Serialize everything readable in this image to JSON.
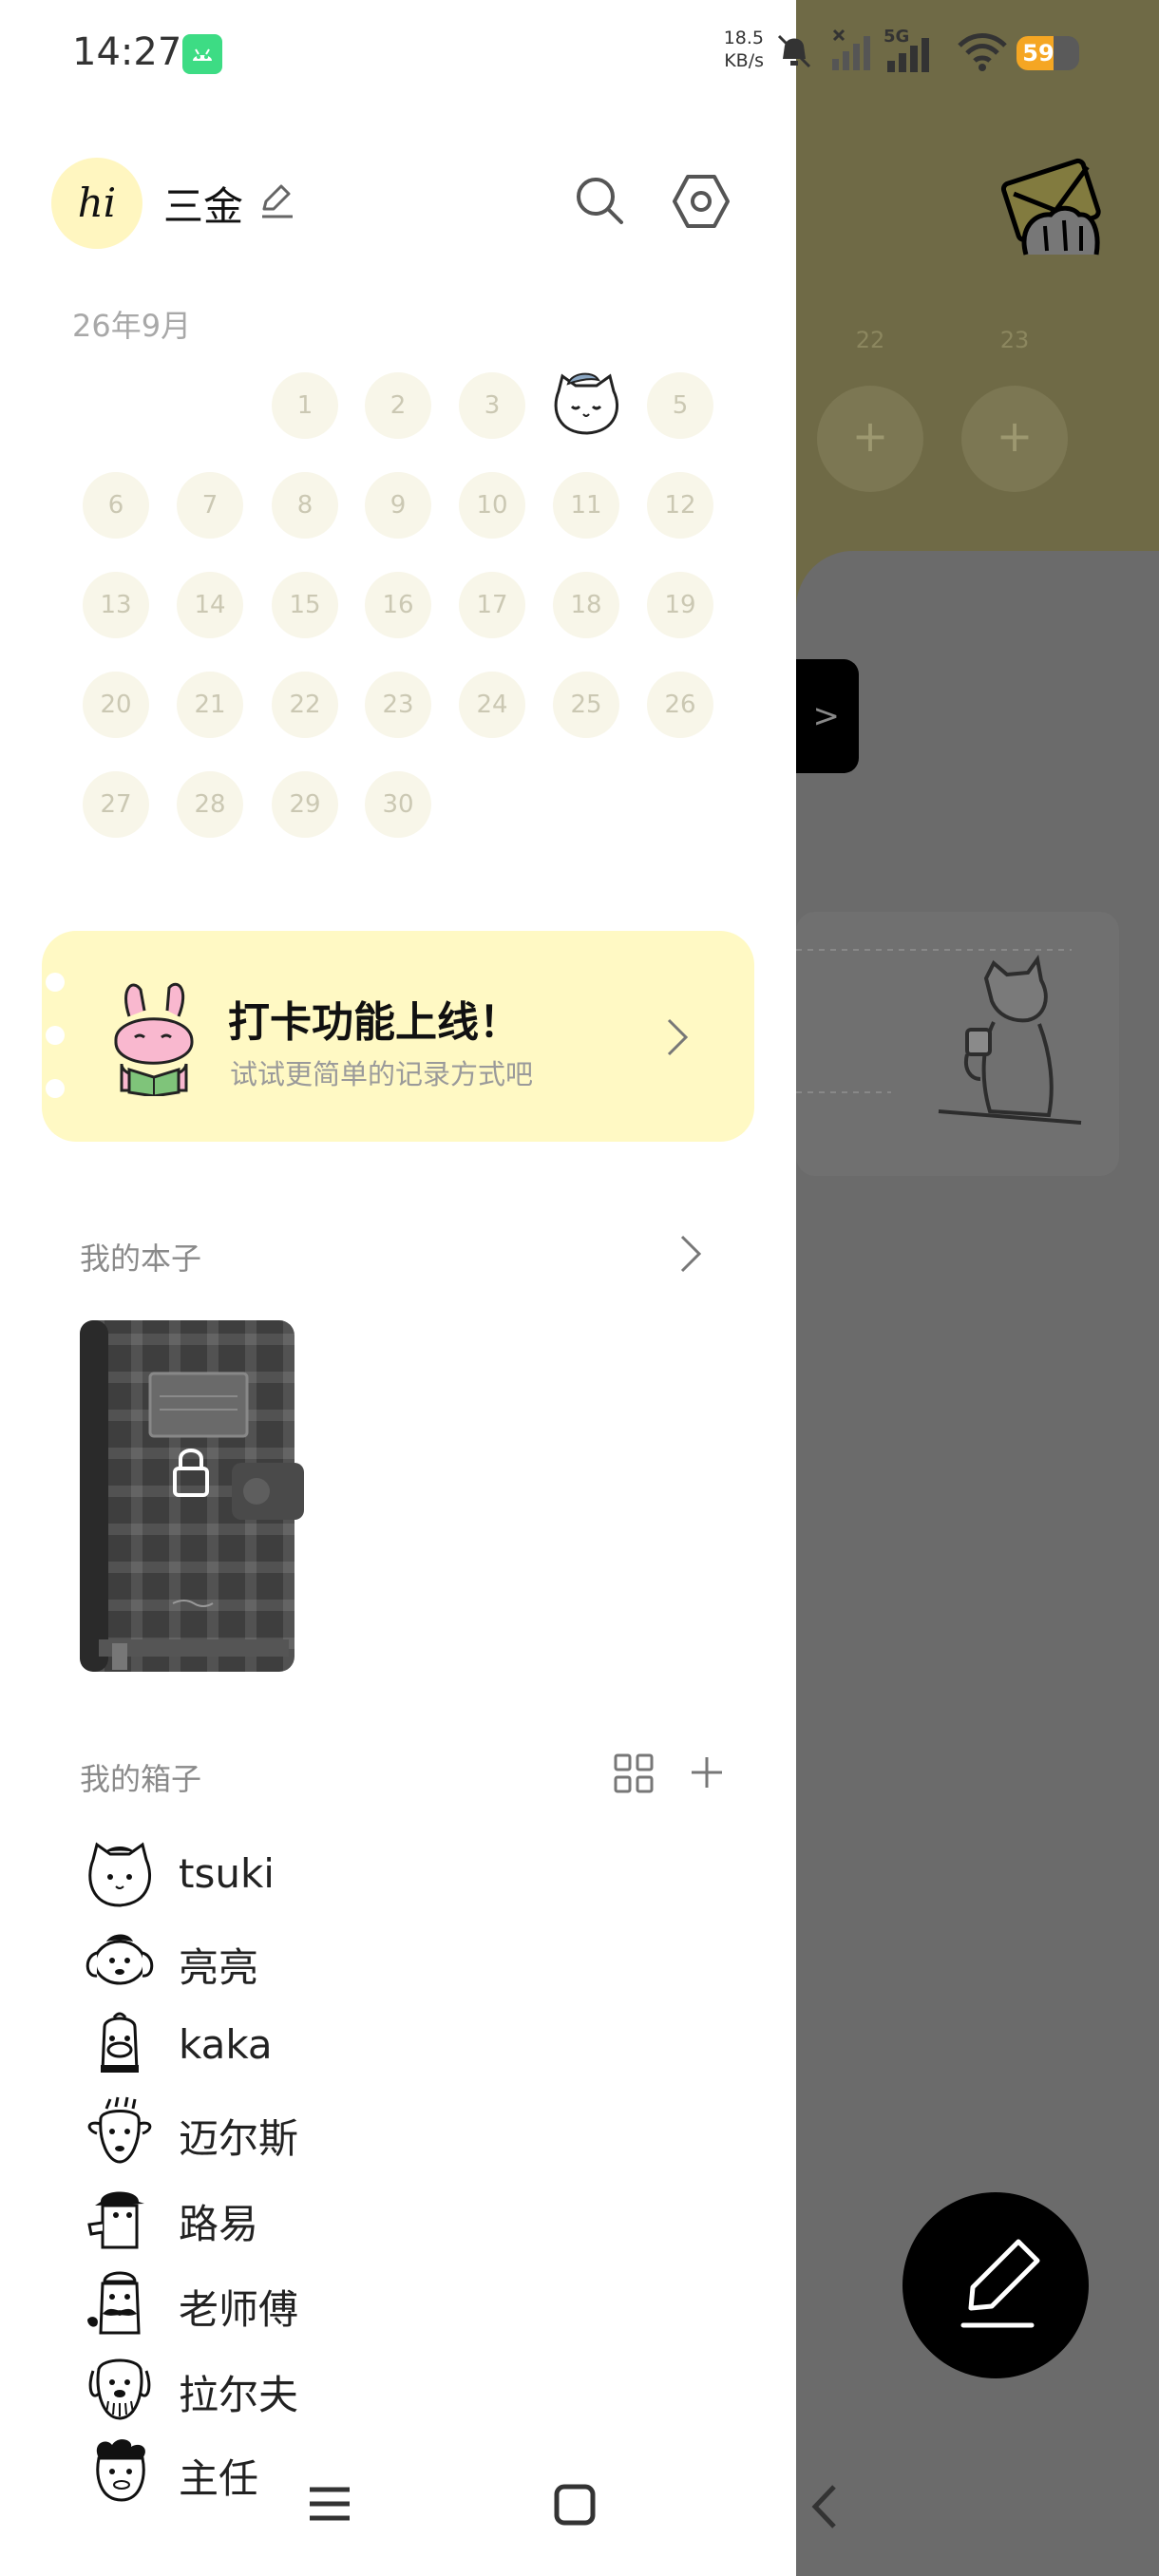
{
  "status_bar": {
    "time": "14:27",
    "net_speed_value": "18.5",
    "net_speed_unit": "KB/s",
    "network": "5G",
    "battery": "59"
  },
  "header": {
    "avatar_text": "hi",
    "username": "三金"
  },
  "calendar": {
    "month_label": "26年9月",
    "days": [
      "1",
      "2",
      "3",
      "4",
      "5",
      "6",
      "7",
      "8",
      "9",
      "10",
      "11",
      "12",
      "13",
      "14",
      "15",
      "16",
      "17",
      "18",
      "19",
      "20",
      "21",
      "22",
      "23",
      "24",
      "25",
      "26",
      "27",
      "28",
      "29",
      "30"
    ],
    "today": "4"
  },
  "banner": {
    "title": "打卡功能上线！",
    "subtitle": "试试更简单的记录方式吧"
  },
  "notebooks": {
    "title": "我的本子"
  },
  "boxes": {
    "title": "我的箱子",
    "items": [
      {
        "name": "tsuki"
      },
      {
        "name": "亮亮"
      },
      {
        "name": "kaka"
      },
      {
        "name": "迈尔斯"
      },
      {
        "name": "路易"
      },
      {
        "name": "老师傅"
      },
      {
        "name": "拉尔夫"
      },
      {
        "name": "主任"
      }
    ]
  },
  "background": {
    "days": [
      "22",
      "23"
    ]
  },
  "colors": {
    "accent_yellow": "#fff9c4",
    "avatar_yellow": "#fff6c0",
    "day_bg": "#f8f6e9",
    "battery": "#f5a623"
  }
}
